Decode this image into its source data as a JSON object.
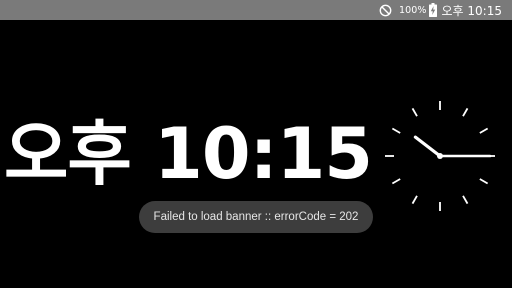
{
  "status_bar": {
    "background": "#7a7a7a",
    "dnd_icon": "do-not-disturb-icon",
    "battery_percent": "100%",
    "battery_icon": "battery-charging-icon",
    "time": "오후 10:15"
  },
  "clock": {
    "digital_time": "오후 10:15",
    "analog_icon": "analog-clock-icon",
    "analog_hour": 10,
    "analog_minute": 15
  },
  "toast": {
    "message": "Failed to load banner :: errorCode = 202"
  },
  "colors": {
    "background": "#000000",
    "foreground": "#ffffff",
    "toast_background": "#3d3d3d"
  }
}
